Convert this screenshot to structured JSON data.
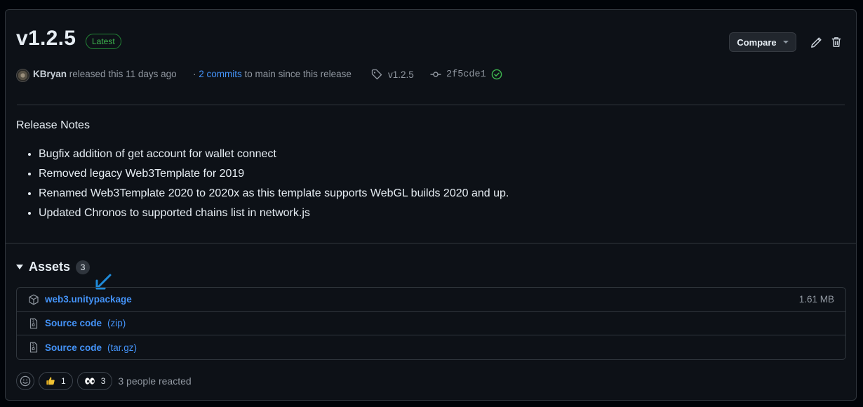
{
  "release": {
    "version": "v1.2.5",
    "badge": "Latest",
    "compare_label": "Compare",
    "author": "KBryan",
    "released_text": "released this 11 days ago",
    "commits_prefix": "·",
    "commits_link": "2 commits",
    "commits_suffix": "to main since this release",
    "tag": "v1.2.5",
    "commit_hash": "2f5cde1"
  },
  "notes": {
    "heading": "Release Notes",
    "items": [
      "Bugfix addition of get account for wallet connect",
      "Removed legacy Web3Template for 2019",
      "Renamed Web3Template 2020 to 2020x as this template supports WebGL builds 2020 and up.",
      "Updated Chronos to supported chains list in network.js"
    ]
  },
  "assets": {
    "title": "Assets",
    "count": "3",
    "rows": [
      {
        "name": "web3.unitypackage",
        "suffix": "",
        "size": "1.61 MB",
        "icon": "package-icon"
      },
      {
        "name": "Source code",
        "suffix": "(zip)",
        "size": "",
        "icon": "file-zip-icon"
      },
      {
        "name": "Source code",
        "suffix": "(tar.gz)",
        "size": "",
        "icon": "file-zip-icon"
      }
    ]
  },
  "reactions": {
    "thumbs_up_count": "1",
    "eyes_count": "3",
    "summary": "3 people reacted"
  },
  "colors": {
    "background": "#0d1117",
    "border": "#30363d",
    "link": "#4493f8",
    "success": "#3fb950",
    "annotation_arrow": "#1f8ad8"
  },
  "icons": [
    "pencil-icon",
    "trash-icon",
    "tag-icon",
    "git-commit-icon",
    "check-circle-icon",
    "package-icon",
    "file-zip-icon",
    "smiley-icon",
    "thumbs-up-icon",
    "eyes-icon",
    "annotation-arrow-icon"
  ]
}
